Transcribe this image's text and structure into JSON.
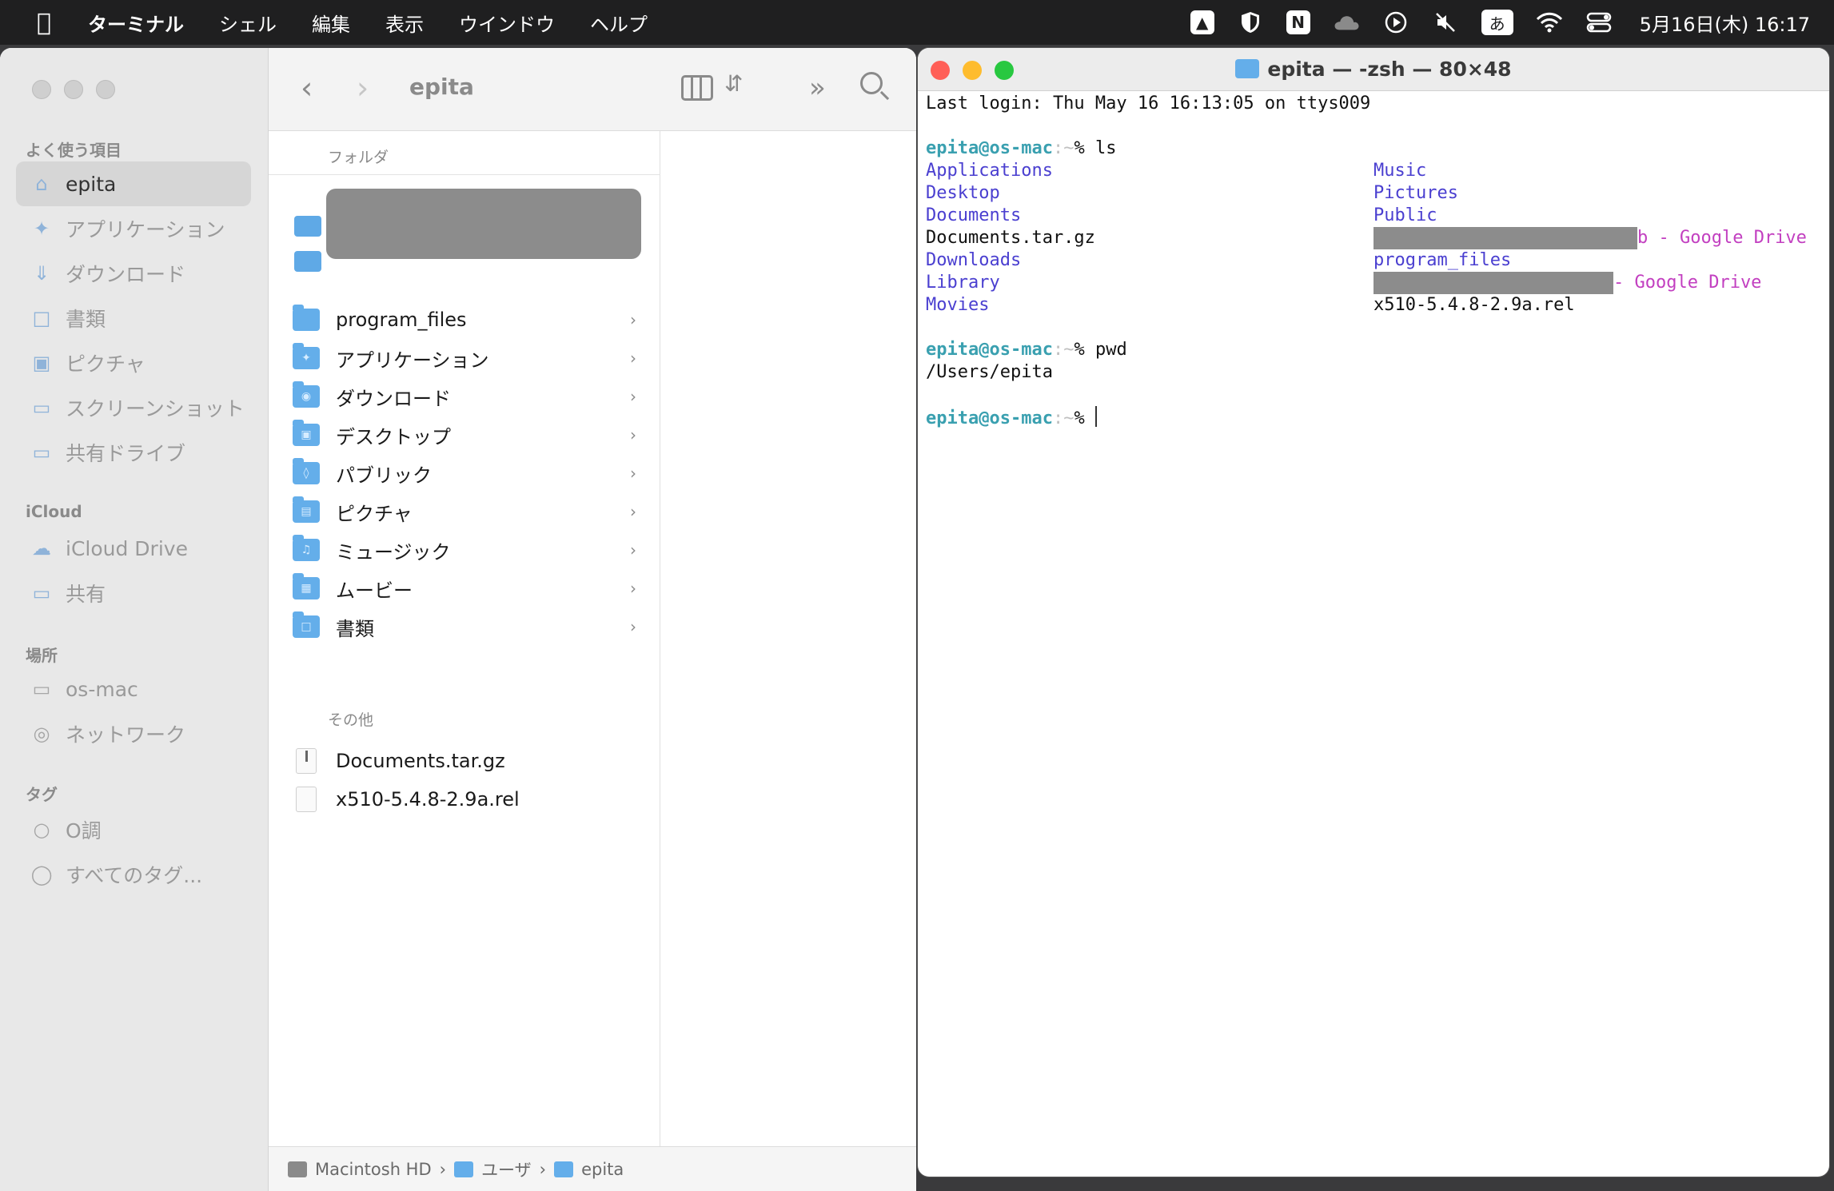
{
  "menubar": {
    "app_name": "ターミナル",
    "items": [
      "シェル",
      "編集",
      "表示",
      "ウインドウ",
      "ヘルプ"
    ],
    "status_icons": {
      "drive": "google-drive-icon",
      "bitwarden": "shield-icon",
      "notion": "N",
      "cloud": "cloud-icon",
      "play": "play-icon",
      "mute": "mute-icon",
      "ime": "あ",
      "wifi": "wifi-icon",
      "control": "control-center-icon"
    },
    "clock": "5月16日(木)  16:17"
  },
  "finder": {
    "title": "epita",
    "sidebar": {
      "favorites_label": "よく使う項目",
      "favorites": [
        {
          "label": "epita",
          "icon": "home-icon"
        },
        {
          "label": "アプリケーション",
          "icon": "applications-icon"
        },
        {
          "label": "ダウンロード",
          "icon": "download-icon"
        },
        {
          "label": "書類",
          "icon": "document-icon"
        },
        {
          "label": "ピクチャ",
          "icon": "photo-icon"
        },
        {
          "label": "スクリーンショット",
          "icon": "folder-icon"
        },
        {
          "label": "共有ドライブ",
          "icon": "folder-icon"
        }
      ],
      "icloud_label": "iCloud",
      "icloud": [
        {
          "label": "iCloud Drive",
          "icon": "cloud-icon"
        },
        {
          "label": "共有",
          "icon": "shared-folder-icon"
        }
      ],
      "locations_label": "場所",
      "locations": [
        {
          "label": "os-mac",
          "icon": "laptop-icon"
        },
        {
          "label": "ネットワーク",
          "icon": "globe-icon"
        }
      ],
      "tags_label": "タグ",
      "tags": [
        {
          "label": "O調",
          "icon": "tag-circle-icon"
        },
        {
          "label": "すべてのタグ...",
          "icon": "all-tags-icon"
        }
      ]
    },
    "column": {
      "folders_header": "フォルダ",
      "folders": [
        "program_files",
        "アプリケーション",
        "ダウンロード",
        "デスクトップ",
        "パブリック",
        "ピクチャ",
        "ミュージック",
        "ムービー",
        "書類"
      ],
      "others_header": "その他",
      "files": [
        "Documents.tar.gz",
        "x510-5.4.8-2.9a.rel"
      ]
    },
    "pathbar": [
      "Macintosh HD",
      "ユーザ",
      "epita"
    ]
  },
  "terminal": {
    "title": "epita — -zsh — 80×48",
    "last_login": "Last login: Thu May 16 16:13:05 on ttys009",
    "prompt_user": "epita@os-mac",
    "prompt_path": ":~",
    "prompt_symbol": "%",
    "cmd1": "ls",
    "ls_left": [
      "Applications",
      "Desktop",
      "Documents",
      "Documents.tar.gz",
      "Downloads",
      "Library",
      "Movies"
    ],
    "ls_right_music": "Music",
    "ls_right_pictures": "Pictures",
    "ls_right_public": "Public",
    "ls_right_gd1_tail": "b - Google Drive",
    "ls_right_program_files": "program_files",
    "ls_right_gd2_tail": "- Google Drive",
    "ls_right_rel": "x510-5.4.8-2.9a.rel",
    "cmd2": "pwd",
    "pwd_output": "/Users/epita"
  }
}
